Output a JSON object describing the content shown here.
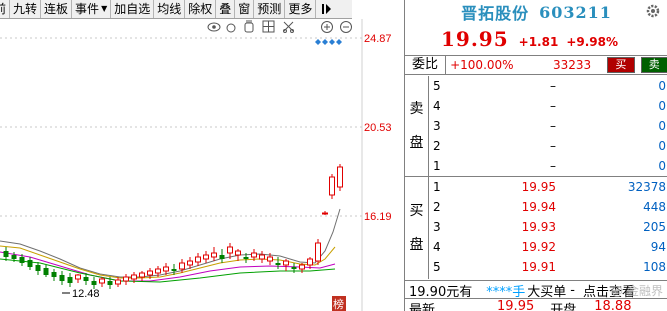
{
  "toolbar": {
    "items": [
      "前",
      "九转",
      "连板",
      "事件",
      "加自选",
      "均线",
      "除权",
      "叠",
      "窗",
      "预测",
      "更多"
    ],
    "pin_icon": "pin-icon"
  },
  "chart": {
    "price_labels": [
      "24.87",
      "20.53",
      "16.19"
    ],
    "crosshair_label": "12.48",
    "mini_icons": [
      "eye-icon",
      "loop-icon",
      "hand-icon",
      "grid-icon",
      "cut-icon",
      "zoom-in-icon",
      "zoom-out-icon"
    ],
    "badge": "榜",
    "up_color": "#e00000",
    "down_color": "#008000"
  },
  "quote": {
    "name": "晋拓股份",
    "code": "603211",
    "price": "19.95",
    "change": "+1.81",
    "change_pct": "+9.98%",
    "settings_icon": "gear-icon"
  },
  "weibi": {
    "label": "委比",
    "ratio": "+100.00%",
    "diff": "33233",
    "buy_label": "买",
    "sell_label": "卖"
  },
  "ask": {
    "side_chars": [
      "卖",
      "盘"
    ],
    "rows": [
      {
        "level": "5",
        "price": "–",
        "volume": "0"
      },
      {
        "level": "4",
        "price": "–",
        "volume": "0"
      },
      {
        "level": "3",
        "price": "–",
        "volume": "0"
      },
      {
        "level": "2",
        "price": "–",
        "volume": "0"
      },
      {
        "level": "1",
        "price": "–",
        "volume": "0"
      }
    ]
  },
  "bid": {
    "side_chars": [
      "买",
      "盘"
    ],
    "rows": [
      {
        "level": "1",
        "price": "19.95",
        "volume": "32378"
      },
      {
        "level": "2",
        "price": "19.94",
        "volume": "448"
      },
      {
        "level": "3",
        "price": "19.93",
        "volume": "205"
      },
      {
        "level": "4",
        "price": "19.92",
        "volume": "94"
      },
      {
        "level": "5",
        "price": "19.91",
        "volume": "108"
      }
    ]
  },
  "tape": {
    "price_text": "19.90元有",
    "stars": "****手",
    "big_buy": "大买单",
    "dash": "-",
    "action": "点击查看"
  },
  "last": {
    "label": "最新",
    "value": "19.95",
    "open_label": "开盘",
    "open_value": "18.88"
  },
  "watermark": "@ 金融界"
}
